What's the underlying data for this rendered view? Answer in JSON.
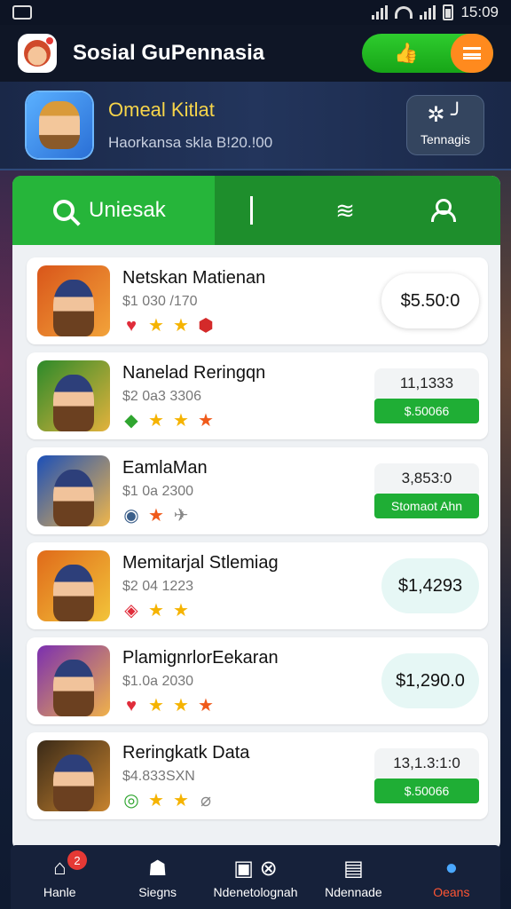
{
  "status_bar": {
    "left_icon": "notification-box-icon",
    "time": "15:09"
  },
  "app": {
    "title": "Sosial GuPennasia",
    "menu_icon": "hamburger-icon",
    "action_icon": "thumbs-up-icon"
  },
  "profile": {
    "name": "Omeal Kitlat",
    "subtitle": "Haorkansa skla B!20.!00",
    "button_label": "Tennagis"
  },
  "tabs": {
    "search_label": "Uniesak"
  },
  "games": [
    {
      "title": "Netskan Matienan",
      "sub": "$1 030 /170",
      "price": "$5.50:0",
      "style": "pill",
      "icons": [
        "heart",
        "star",
        "star",
        "gem"
      ],
      "colors": [
        "#d9561a",
        "#f2a33a"
      ]
    },
    {
      "title": "Nanelad Reringqn",
      "sub": "$2 0a3 3306",
      "price": "11,1333",
      "button": "$.50066",
      "style": "stack",
      "icons": [
        "leaf",
        "star",
        "star",
        "star-small"
      ],
      "colors": [
        "#2c8a2a",
        "#e3b23c"
      ]
    },
    {
      "title": "EamlaMan",
      "sub": "$1 0a 2300",
      "price": "3,853:0",
      "button": "Stomaot Ahn",
      "style": "stack",
      "icons": [
        "shield",
        "star-red",
        "plane"
      ],
      "colors": [
        "#1b4fb8",
        "#f0b64a"
      ]
    },
    {
      "title": "Memitarjal Stlemiag",
      "sub": "$2 04 1223",
      "price": "$1,4293",
      "style": "mint",
      "icons": [
        "shield-red",
        "star",
        "star"
      ],
      "colors": [
        "#e06a1a",
        "#f2c43a"
      ]
    },
    {
      "title": "PlamignrlorEekaran",
      "sub": "$1.0a 2030",
      "price": "$1,290.0",
      "style": "mint",
      "icons": [
        "heart",
        "star",
        "star",
        "star-small"
      ],
      "colors": [
        "#7b2fb0",
        "#f0b24a"
      ]
    },
    {
      "title": "Reringkatk Data",
      "sub": "$4.833SXN",
      "price": "13,1.3:1:0",
      "button": "$.50066",
      "style": "stack",
      "icons": [
        "circle-green",
        "star",
        "star",
        "tag"
      ],
      "colors": [
        "#3a2a18",
        "#c7832e"
      ]
    }
  ],
  "bottom_nav": [
    {
      "label": "Hanle",
      "icon": "home-icon",
      "badge": "2"
    },
    {
      "label": "Siegns",
      "icon": "ghost-icon"
    },
    {
      "label": "Ndenetolognah",
      "icon": "calendar-close-icon"
    },
    {
      "label": "Ndennade",
      "icon": "chart-icon"
    },
    {
      "label": "Oeans",
      "icon": "profile-icon",
      "active": true
    }
  ]
}
